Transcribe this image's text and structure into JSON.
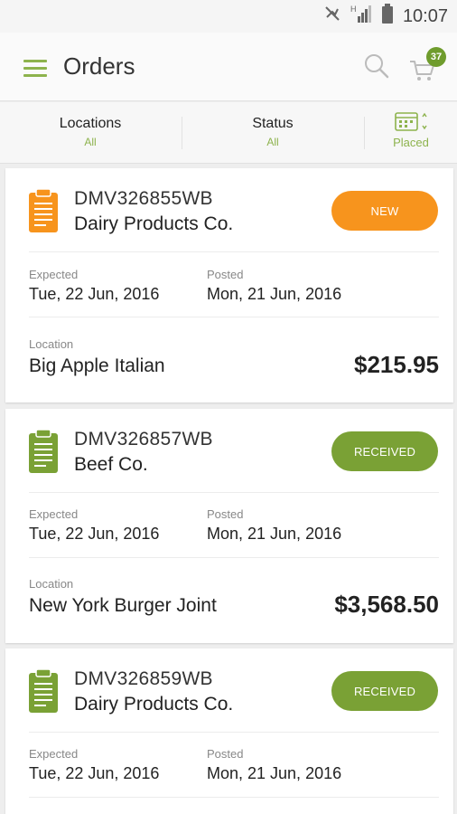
{
  "status_bar": {
    "time": "10:07",
    "icons": [
      "mute-icon",
      "signal-icon",
      "battery-icon"
    ]
  },
  "app_bar": {
    "title": "Orders",
    "cart_count": "37",
    "icons": [
      "menu-icon",
      "search-icon",
      "cart-icon"
    ],
    "accent": "#8db34d"
  },
  "filters": {
    "locations": {
      "label": "Locations",
      "value": "All"
    },
    "status": {
      "label": "Status",
      "value": "All"
    },
    "date": {
      "value": "Placed",
      "icon": "calendar-icon"
    }
  },
  "colors": {
    "new": "#f7941d",
    "received": "#7aa135",
    "accent": "#8db34d"
  },
  "orders": [
    {
      "order_no": "DMV326855WB",
      "supplier": "Dairy Products Co.",
      "status": "NEW",
      "expected_label": "Expected",
      "expected": "Tue, 22 Jun, 2016",
      "posted_label": "Posted",
      "posted": "Mon, 21 Jun, 2016",
      "location_label": "Location",
      "location": "Big Apple Italian",
      "amount": "$215.95"
    },
    {
      "order_no": "DMV326857WB",
      "supplier": "Beef Co.",
      "status": "RECEIVED",
      "expected_label": "Expected",
      "expected": "Tue, 22 Jun, 2016",
      "posted_label": "Posted",
      "posted": "Mon, 21 Jun, 2016",
      "location_label": "Location",
      "location": "New York Burger Joint",
      "amount": "$3,568.50"
    },
    {
      "order_no": "DMV326859WB",
      "supplier": "Dairy Products Co.",
      "status": "RECEIVED",
      "expected_label": "Expected",
      "expected": "Tue, 22 Jun, 2016",
      "posted_label": "Posted",
      "posted": "Mon, 21 Jun, 2016"
    }
  ]
}
